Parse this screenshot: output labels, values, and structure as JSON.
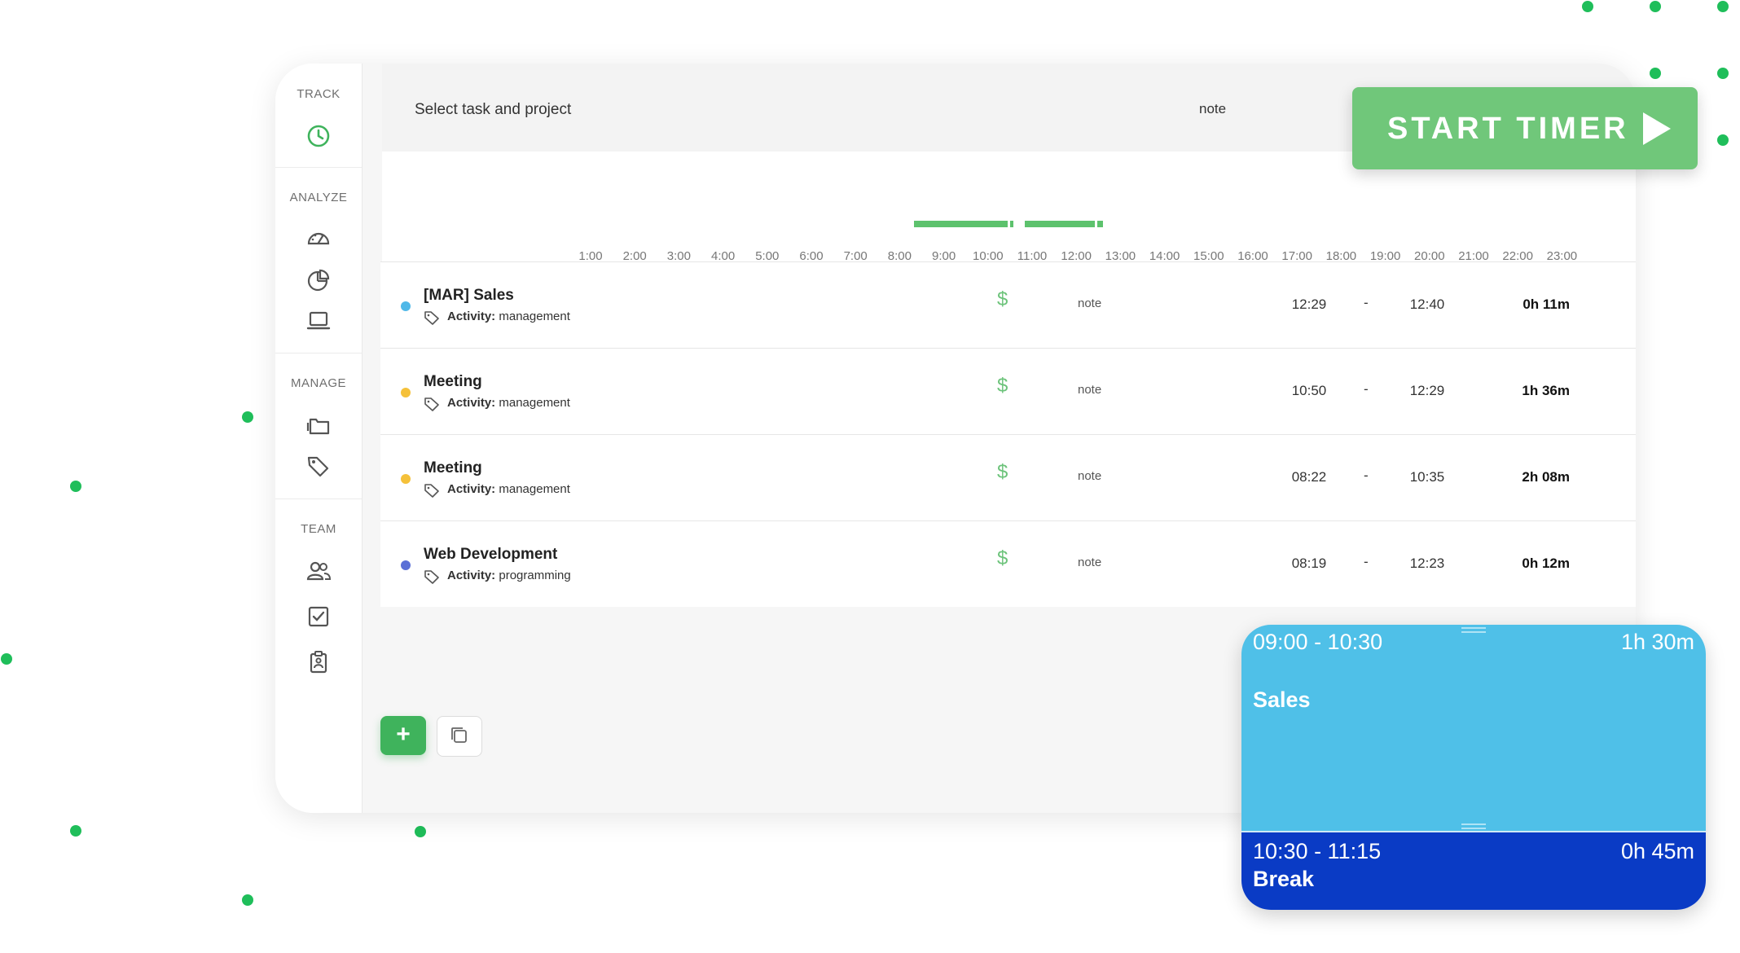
{
  "sidebar": {
    "sections": [
      {
        "label": "TRACK"
      },
      {
        "label": "ANALYZE"
      },
      {
        "label": "MANAGE"
      },
      {
        "label": "TEAM"
      }
    ],
    "icons": [
      "clock-icon",
      "dashboard-icon",
      "pie-chart-icon",
      "laptop-icon",
      "folder-icon",
      "tags-icon",
      "team-icon",
      "checkbox-icon",
      "clipboard-icon"
    ]
  },
  "topbar": {
    "task_placeholder": "Select task and project",
    "note_placeholder": "note",
    "start_timer_label": "START TIMER"
  },
  "timeline": {
    "hours": [
      "1:00",
      "2:00",
      "3:00",
      "4:00",
      "5:00",
      "6:00",
      "7:00",
      "8:00",
      "9:00",
      "10:00",
      "11:00",
      "12:00",
      "13:00",
      "14:00",
      "15:00",
      "16:00",
      "17:00",
      "18:00",
      "19:00",
      "20:00",
      "21:00",
      "22:00",
      "23:00"
    ],
    "tracked_color": "#5dc26d"
  },
  "entries": [
    {
      "title": "[MAR] Sales",
      "activity_prefix": "Activity:",
      "activity": "management",
      "color": "#4fb8e8",
      "billable": "$",
      "note": "note",
      "start": "12:29",
      "sep": "-",
      "end": "12:40",
      "duration": "0h 11m"
    },
    {
      "title": "Meeting",
      "activity_prefix": "Activity:",
      "activity": "management",
      "color": "#f5c13a",
      "billable": "$",
      "note": "note",
      "start": "10:50",
      "sep": "-",
      "end": "12:29",
      "duration": "1h 36m"
    },
    {
      "title": "Meeting",
      "activity_prefix": "Activity:",
      "activity": "management",
      "color": "#f5c13a",
      "billable": "$",
      "note": "note",
      "start": "08:22",
      "sep": "-",
      "end": "10:35",
      "duration": "2h 08m"
    },
    {
      "title": "Web Development",
      "activity_prefix": "Activity:",
      "activity": "programming",
      "color": "#5a6fd6",
      "billable": "$",
      "note": "note",
      "start": "08:19",
      "sep": "-",
      "end": "12:23",
      "duration": "0h 12m"
    }
  ],
  "actions": {
    "add_label": "+"
  },
  "calendar_card": {
    "block1": {
      "time": "09:00 - 10:30",
      "duration": "1h 30m",
      "title": "Sales",
      "color": "#4fc0e8"
    },
    "block2": {
      "time": "10:30 - 11:15",
      "duration": "0h 45m",
      "title": "Break",
      "color": "#0a3bc5"
    }
  },
  "colors": {
    "accent": "#3fb35c",
    "dot": "#1fbe5a"
  }
}
